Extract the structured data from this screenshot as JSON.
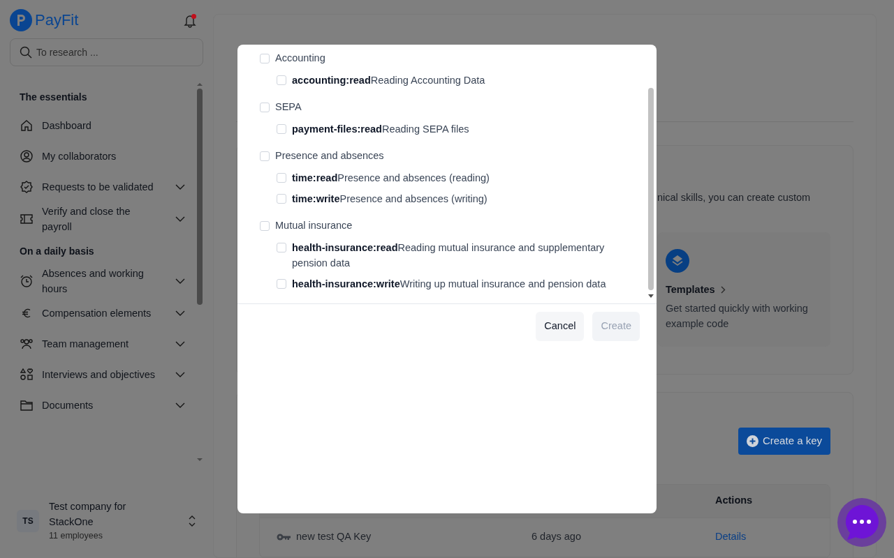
{
  "app": {
    "logo": "PayFit",
    "notifications": {
      "unread": true
    }
  },
  "search": {
    "placeholder": "To research ..."
  },
  "sidebar": {
    "sections": [
      {
        "title": "The essentials",
        "items": [
          {
            "label": "Dashboard",
            "expandable": false
          },
          {
            "label": "My collaborators",
            "expandable": false
          },
          {
            "label": "Requests to be validated",
            "expandable": true
          },
          {
            "label": "Verify and close the payroll",
            "expandable": true
          }
        ]
      },
      {
        "title": "On a daily basis",
        "items": [
          {
            "label": "Absences and working hours",
            "expandable": true
          },
          {
            "label": "Compensation elements",
            "expandable": true
          },
          {
            "label": "Team management",
            "expandable": true
          },
          {
            "label": "Interviews and objectives",
            "expandable": true
          },
          {
            "label": "Documents",
            "expandable": true
          }
        ]
      }
    ]
  },
  "company": {
    "initials": "TS",
    "name": "Test company for StackOne",
    "employees": "11 employees"
  },
  "background": {
    "intro_fragment": "nical skills, you can create custom",
    "templates": {
      "title": "Templates",
      "description": "Get started quickly with working example code"
    },
    "create_key": "Create a key",
    "table": {
      "columns": [
        "Actions"
      ],
      "rows": [
        {
          "name": "new test QA Key",
          "created": "6 days ago",
          "action": "Details"
        }
      ]
    }
  },
  "modal": {
    "groups": [
      {
        "label": "Accounting",
        "checked": false,
        "scopes": [
          {
            "text": "**accounting:read**Reading Accounting Data",
            "checked": false
          }
        ]
      },
      {
        "label": "SEPA",
        "checked": false,
        "scopes": [
          {
            "text": "**payment-files:read**Reading SEPA files",
            "checked": false
          }
        ]
      },
      {
        "label": "Presence and absences",
        "checked": false,
        "scopes": [
          {
            "text": "**time:read**Presence and absences (reading)",
            "checked": false
          },
          {
            "text": "**time:write**Presence and absences (writing)",
            "checked": false
          }
        ]
      },
      {
        "label": "Mutual insurance",
        "checked": false,
        "scopes": [
          {
            "text": "**health-insurance:read**Reading mutual insurance and supplementary pension data",
            "checked": false
          },
          {
            "text": "**health-insurance:write**Writing up mutual insurance and pension data",
            "checked": false
          }
        ]
      }
    ],
    "buttons": [
      {
        "label": "Cancel",
        "disabled": false
      },
      {
        "label": "Create",
        "disabled": true
      }
    ]
  }
}
